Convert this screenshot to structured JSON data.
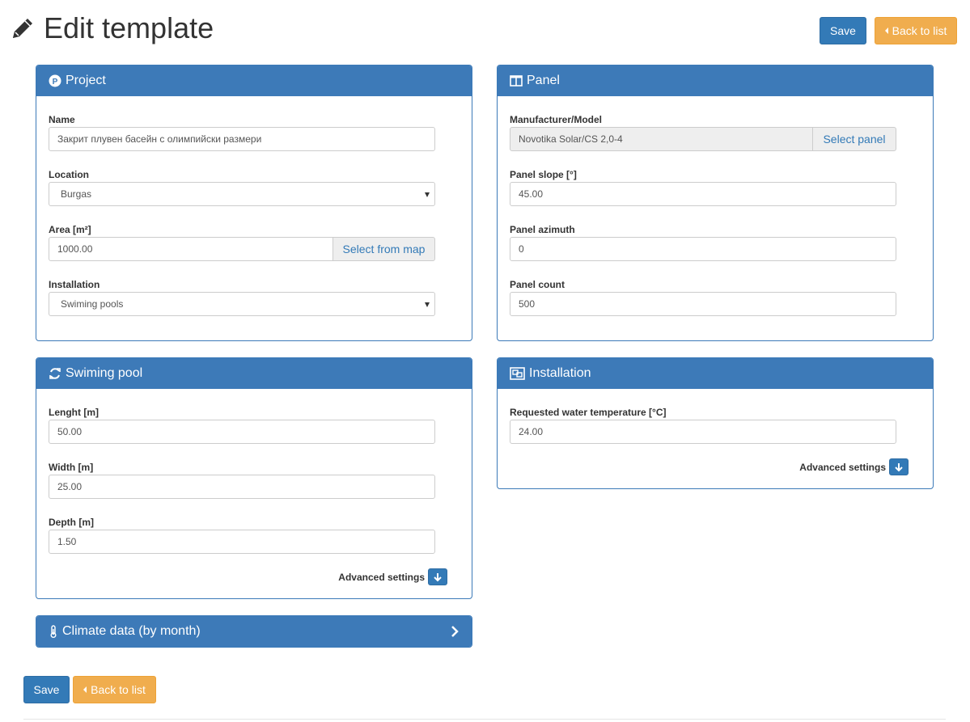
{
  "header": {
    "title": "Edit template",
    "save_label": "Save",
    "back_label": "Back to list"
  },
  "project": {
    "title": "Project",
    "name_label": "Name",
    "name_value": "Закрит плувен басейн с олимпийски размери",
    "location_label": "Location",
    "location_value": "Burgas",
    "area_label": "Area [m²]",
    "area_value": "1000.00",
    "select_map_label": "Select from map",
    "installation_label": "Installation",
    "installation_value": "Swiming pools"
  },
  "panel": {
    "title": "Panel",
    "model_label": "Manufacturer/Model",
    "model_value": "Novotika Solar/CS 2,0-4",
    "select_panel_label": "Select panel",
    "slope_label": "Panel slope [°]",
    "slope_value": "45.00",
    "azimuth_label": "Panel azimuth",
    "azimuth_value": "0",
    "count_label": "Panel count",
    "count_value": "500"
  },
  "pool": {
    "title": "Swiming pool",
    "length_label": "Lenght [m]",
    "length_value": "50.00",
    "width_label": "Width [m]",
    "width_value": "25.00",
    "depth_label": "Depth [m]",
    "depth_value": "1.50",
    "advanced_label": "Advanced settings"
  },
  "installation": {
    "title": "Installation",
    "temp_label": "Requested water temperature [°C]",
    "temp_value": "24.00",
    "advanced_label": "Advanced settings"
  },
  "climate": {
    "title": "Climate data (by month)"
  },
  "footer": {
    "save_label": "Save",
    "back_label": "Back to list"
  },
  "colors": {
    "primary": "#337ab7",
    "panel_header": "#3d7ab8",
    "warning": "#f0ad4e"
  }
}
